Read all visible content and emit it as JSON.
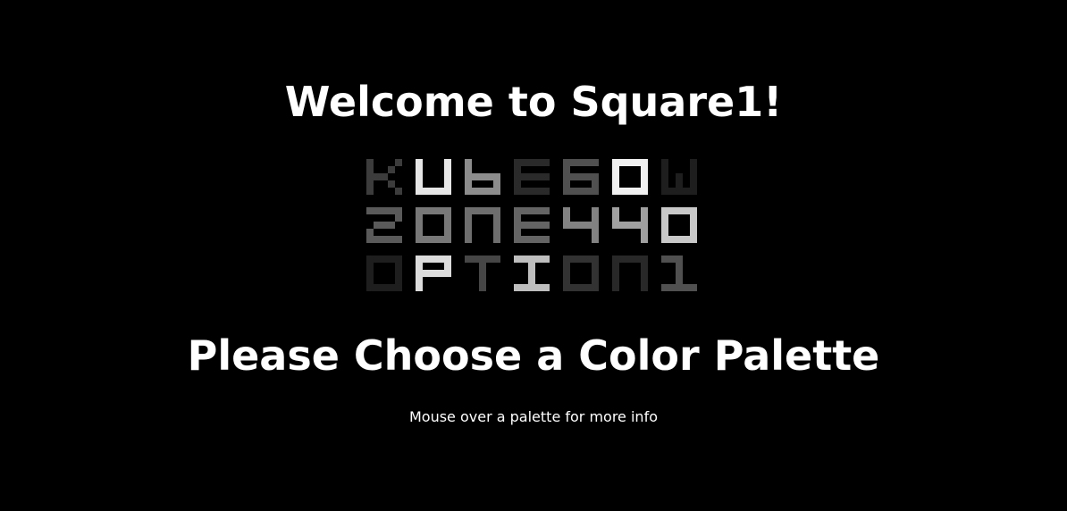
{
  "header": {
    "title": "Welcome to Square1!"
  },
  "palettes": {
    "rows": [
      {
        "name": "KUBE6OW",
        "glyphs": [
          {
            "char": "K",
            "color": "#3c3c3c"
          },
          {
            "char": "U",
            "color": "#e6e6e6"
          },
          {
            "char": "b",
            "color": "#8c8c8c"
          },
          {
            "char": "E",
            "color": "#2a2a2a"
          },
          {
            "char": "6",
            "color": "#505050"
          },
          {
            "char": "O",
            "color": "#f0f0f0"
          },
          {
            "char": "W",
            "color": "#1e1e1e"
          }
        ]
      },
      {
        "name": "ZONE440",
        "glyphs": [
          {
            "char": "Z",
            "color": "#5a5a5a"
          },
          {
            "char": "O",
            "color": "#787878"
          },
          {
            "char": "N",
            "color": "#6e6e6e"
          },
          {
            "char": "E",
            "color": "#646464"
          },
          {
            "char": "4",
            "color": "#828282"
          },
          {
            "char": "4",
            "color": "#a0a0a0"
          },
          {
            "char": "O",
            "color": "#c8c8c8"
          }
        ]
      },
      {
        "name": "OPTION1",
        "glyphs": [
          {
            "char": "O",
            "color": "#1e1e1e"
          },
          {
            "char": "P",
            "color": "#dcdcdc"
          },
          {
            "char": "T",
            "color": "#464646"
          },
          {
            "char": "I",
            "color": "#bebebe"
          },
          {
            "char": "O",
            "color": "#323232"
          },
          {
            "char": "N",
            "color": "#282828"
          },
          {
            "char": "1",
            "color": "#505050"
          }
        ]
      }
    ]
  },
  "main": {
    "heading": "Please Choose a Color Palette",
    "hint": "Mouse over a palette for more info"
  }
}
